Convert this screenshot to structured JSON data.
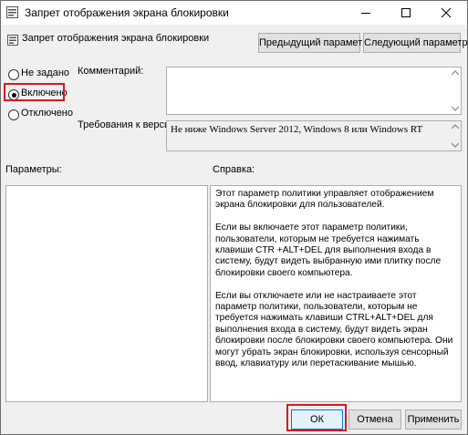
{
  "window": {
    "title": "Запрет отображения экрана блокировки",
    "icons": {
      "app": "policy-icon",
      "minimize": "minimize-icon",
      "maximize": "maximize-icon",
      "close": "close-icon"
    }
  },
  "header": {
    "title": "Запрет отображения экрана блокировки",
    "prev_label": "Предыдущий параметр",
    "next_label": "Следующий параметр"
  },
  "state": {
    "options": [
      {
        "label": "Не задано",
        "checked": false
      },
      {
        "label": "Включено",
        "checked": true
      },
      {
        "label": "Отключено",
        "checked": false
      }
    ]
  },
  "comment": {
    "label": "Комментарий:",
    "value": ""
  },
  "version": {
    "label": "Требования к версии:",
    "value": "Не ниже Windows Server 2012, Windows 8 или Windows RT"
  },
  "params": {
    "label": "Параметры:"
  },
  "help": {
    "label": "Справка:",
    "paragraphs": [
      "Этот параметр политики управляет отображением экрана блокировки для пользователей.",
      "Если вы включаете этот параметр политики, пользователи, которым не требуется нажимать клавиши CTR +ALT+DEL для выполнения входа в систему, будут видеть выбранную ими плитку после блокировки своего компьютера.",
      "Если вы отключаете или не настраиваете этот параметр политики, пользователи, которым не требуется нажимать клавиши CTRL+ALT+DEL для выполнения входа в систему, будут видеть экран блокировки после блокировки своего компьютера. Они могут убрать экран блокировки, используя сенсорный ввод, клавиатуру или перетаскивание мышью."
    ]
  },
  "footer": {
    "ok": "ОК",
    "cancel": "Отмена",
    "apply": "Применить"
  },
  "colors": {
    "highlight": "#d11c24",
    "default_button_border": "#0078d7"
  }
}
